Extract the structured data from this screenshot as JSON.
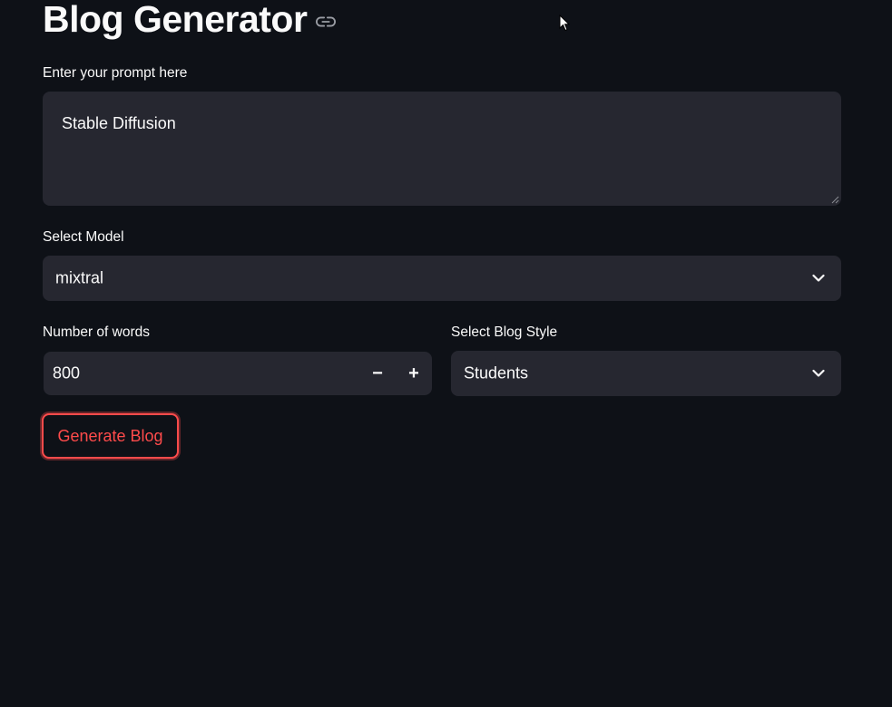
{
  "header": {
    "title": "Blog Generator",
    "anchor_icon": "link-icon"
  },
  "prompt": {
    "label": "Enter your prompt here",
    "value": "Stable Diffusion"
  },
  "model": {
    "label": "Select Model",
    "value": "mixtral",
    "icon": "chevron-down-icon"
  },
  "words": {
    "label": "Number of words",
    "value": "800",
    "minus_label": "−",
    "plus_label": "+"
  },
  "style": {
    "label": "Select Blog Style",
    "value": "Students",
    "icon": "chevron-down-icon"
  },
  "actions": {
    "generate_label": "Generate Blog"
  },
  "colors": {
    "background": "#0e1117",
    "input_background": "#262730",
    "text": "#fafafa",
    "accent": "#ff4b4b"
  }
}
